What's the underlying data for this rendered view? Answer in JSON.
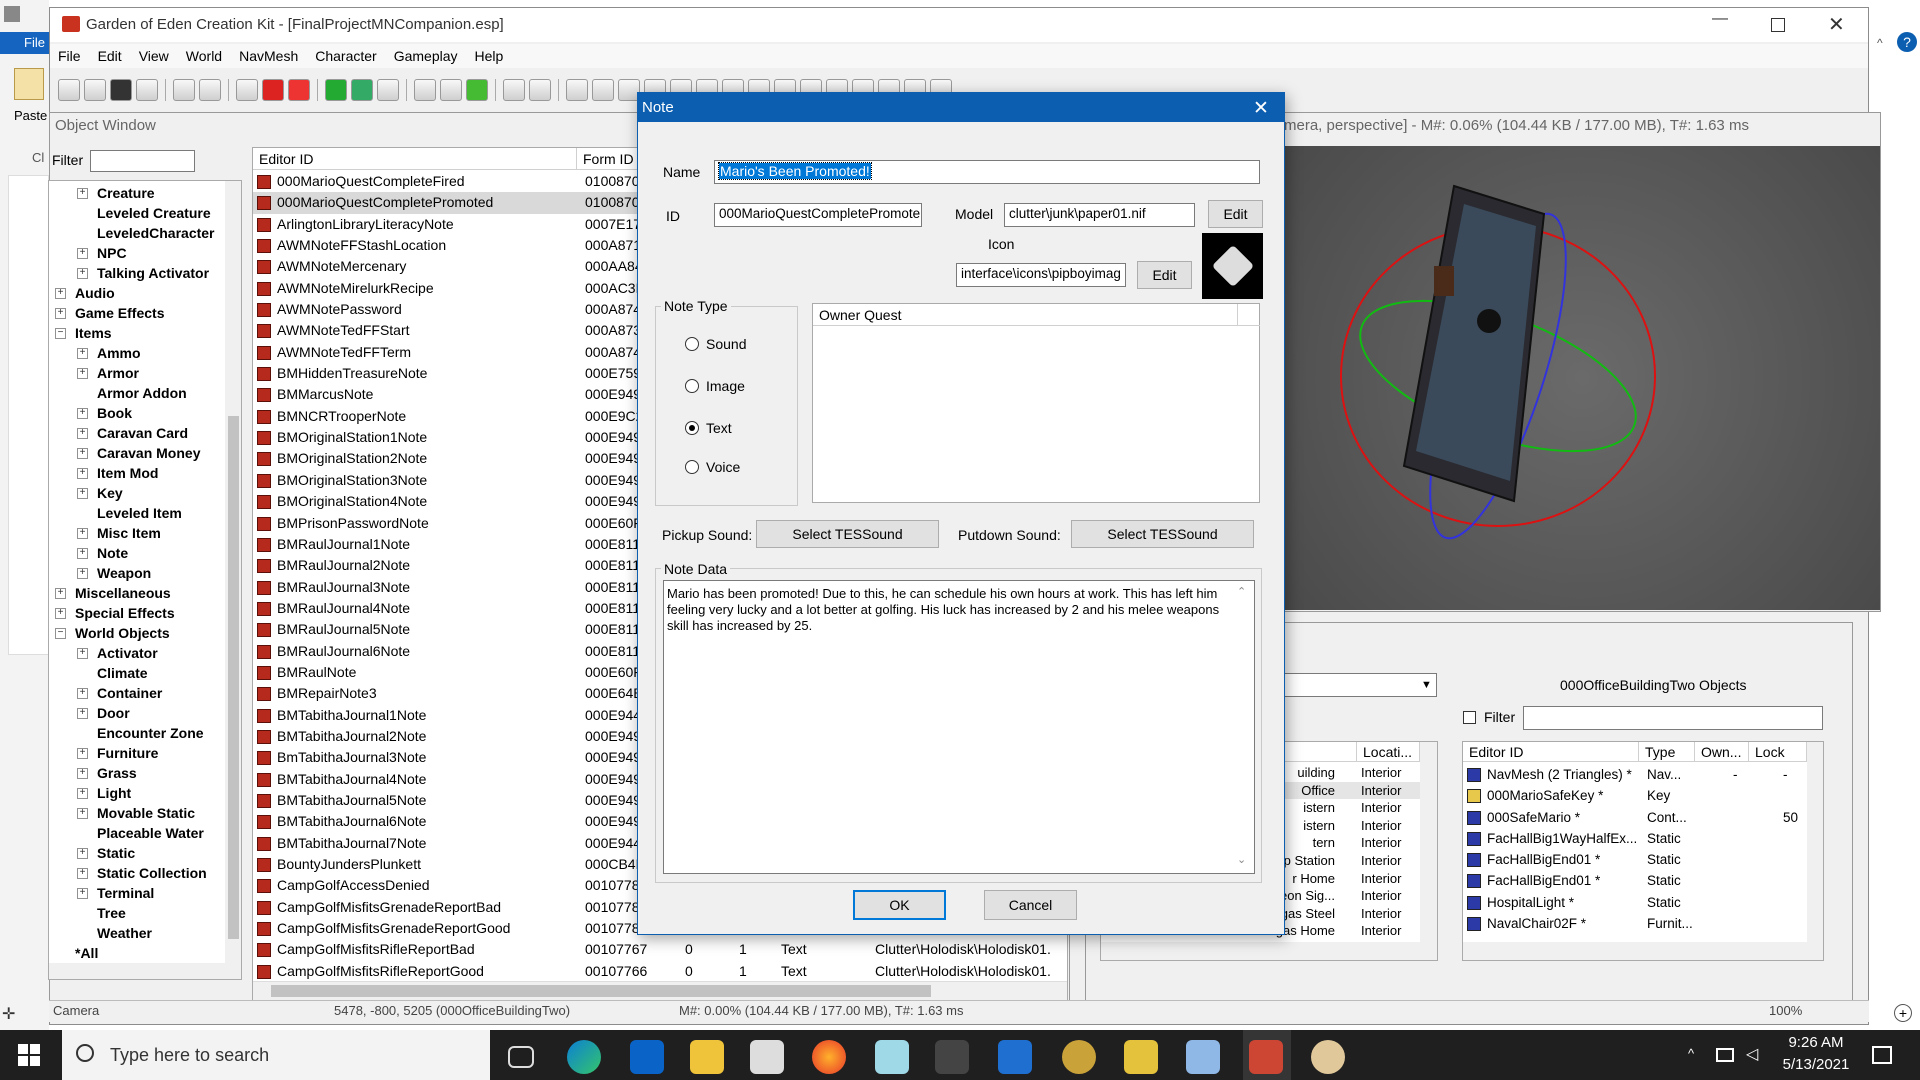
{
  "titlebar": {
    "title": "Garden of Eden Creation Kit - [FinalProjectMNCompanion.esp]"
  },
  "left_ribbon": {
    "file_tab": "File",
    "paste_label": "Paste",
    "cl_label": "Cl"
  },
  "menu": [
    "File",
    "Edit",
    "View",
    "World",
    "NavMesh",
    "Character",
    "Gameplay",
    "Help"
  ],
  "object_window": {
    "title": "Object Window",
    "filter_label": "Filter",
    "tree": [
      {
        "label": "Creature",
        "indent": 1,
        "toggle": "+"
      },
      {
        "label": "Leveled Creature",
        "indent": 2,
        "toggle": ""
      },
      {
        "label": "LeveledCharacter",
        "indent": 2,
        "toggle": ""
      },
      {
        "label": "NPC",
        "indent": 1,
        "toggle": "+"
      },
      {
        "label": "Talking Activator",
        "indent": 1,
        "toggle": "+"
      },
      {
        "label": "Audio",
        "indent": 0,
        "toggle": "+"
      },
      {
        "label": "Game Effects",
        "indent": 0,
        "toggle": "+"
      },
      {
        "label": "Items",
        "indent": 0,
        "toggle": "-"
      },
      {
        "label": "Ammo",
        "indent": 1,
        "toggle": "+"
      },
      {
        "label": "Armor",
        "indent": 1,
        "toggle": "+"
      },
      {
        "label": "Armor Addon",
        "indent": 2,
        "toggle": ""
      },
      {
        "label": "Book",
        "indent": 1,
        "toggle": "+"
      },
      {
        "label": "Caravan Card",
        "indent": 1,
        "toggle": "+"
      },
      {
        "label": "Caravan Money",
        "indent": 1,
        "toggle": "+"
      },
      {
        "label": "Item Mod",
        "indent": 1,
        "toggle": "+"
      },
      {
        "label": "Key",
        "indent": 1,
        "toggle": "+"
      },
      {
        "label": "Leveled Item",
        "indent": 2,
        "toggle": ""
      },
      {
        "label": "Misc Item",
        "indent": 1,
        "toggle": "+"
      },
      {
        "label": "Note",
        "indent": 1,
        "toggle": "+"
      },
      {
        "label": "Weapon",
        "indent": 1,
        "toggle": "+"
      },
      {
        "label": "Miscellaneous",
        "indent": 0,
        "toggle": "+"
      },
      {
        "label": "Special Effects",
        "indent": 0,
        "toggle": "+"
      },
      {
        "label": "World Objects",
        "indent": 0,
        "toggle": "-"
      },
      {
        "label": "Activator",
        "indent": 1,
        "toggle": "+"
      },
      {
        "label": "Climate",
        "indent": 2,
        "toggle": ""
      },
      {
        "label": "Container",
        "indent": 1,
        "toggle": "+"
      },
      {
        "label": "Door",
        "indent": 1,
        "toggle": "+"
      },
      {
        "label": "Encounter Zone",
        "indent": 2,
        "toggle": ""
      },
      {
        "label": "Furniture",
        "indent": 1,
        "toggle": "+"
      },
      {
        "label": "Grass",
        "indent": 1,
        "toggle": "+"
      },
      {
        "label": "Light",
        "indent": 1,
        "toggle": "+"
      },
      {
        "label": "Movable Static",
        "indent": 1,
        "toggle": "+"
      },
      {
        "label": "Placeable Water",
        "indent": 2,
        "toggle": ""
      },
      {
        "label": "Static",
        "indent": 1,
        "toggle": "+"
      },
      {
        "label": "Static Collection",
        "indent": 1,
        "toggle": "+"
      },
      {
        "label": "Terminal",
        "indent": 1,
        "toggle": "+"
      },
      {
        "label": "Tree",
        "indent": 2,
        "toggle": ""
      },
      {
        "label": "Weather",
        "indent": 2,
        "toggle": ""
      },
      {
        "label": "*All",
        "indent": 0,
        "toggle": ""
      }
    ],
    "list_headers": [
      "Editor ID",
      "Form ID"
    ],
    "rows": [
      [
        "000MarioQuestCompleteFired",
        "0100870"
      ],
      [
        "000MarioQuestCompletePromoted",
        "0100870"
      ],
      [
        "ArlingtonLibraryLiteracyNote",
        "0007E17"
      ],
      [
        "AWMNoteFFStashLocation",
        "000A871"
      ],
      [
        "AWMNoteMercenary",
        "000AA84"
      ],
      [
        "AWMNoteMirelurkRecipe",
        "000AC3E"
      ],
      [
        "AWMNotePassword",
        "000A874"
      ],
      [
        "AWMNoteTedFFStart",
        "000A873"
      ],
      [
        "AWMNoteTedFFTerm",
        "000A874"
      ],
      [
        "BMHiddenTreasureNote",
        "000E759"
      ],
      [
        "BMMarcusNote",
        "000E949"
      ],
      [
        "BMNCRTrooperNote",
        "000E9C2"
      ],
      [
        "BMOriginalStation1Note",
        "000E949"
      ],
      [
        "BMOriginalStation2Note",
        "000E949"
      ],
      [
        "BMOriginalStation3Note",
        "000E949"
      ],
      [
        "BMOriginalStation4Note",
        "000E949"
      ],
      [
        "BMPrisonPasswordNote",
        "000E60F"
      ],
      [
        "BMRaulJournal1Note",
        "000E811"
      ],
      [
        "BMRaulJournal2Note",
        "000E811"
      ],
      [
        "BMRaulJournal3Note",
        "000E811"
      ],
      [
        "BMRaulJournal4Note",
        "000E811"
      ],
      [
        "BMRaulJournal5Note",
        "000E811"
      ],
      [
        "BMRaulJournal6Note",
        "000E811"
      ],
      [
        "BMRaulNote",
        "000E60F"
      ],
      [
        "BMRepairNote3",
        "000E64B"
      ],
      [
        "BMTabithaJournal1Note",
        "000E944"
      ],
      [
        "BMTabithaJournal2Note",
        "000E949"
      ],
      [
        "BmTabithaJournal3Note",
        "000E949"
      ],
      [
        "BMTabithaJournal4Note",
        "000E949"
      ],
      [
        "BMTabithaJournal5Note",
        "000E949"
      ],
      [
        "BMTabithaJournal6Note",
        "000E949"
      ],
      [
        "BMTabithaJournal7Note",
        "000E944"
      ],
      [
        "BountyJundersPlunkett",
        "000CB4F"
      ],
      [
        "CampGolfAccessDenied",
        "0010778"
      ],
      [
        "CampGolfMisfitsGrenadeReportBad",
        "0010778"
      ],
      [
        "CampGolfMisfitsGrenadeReportGood",
        "0010778"
      ],
      [
        "CampGolfMisfitsRifleReportBad",
        "00107767"
      ],
      [
        "CampGolfMisfitsRifleReportGood",
        "00107766"
      ]
    ],
    "extra_cols": [
      {
        "count": "0",
        "users": "1",
        "type": "Text",
        "model": "Clutter\\Holodisk\\Holodisk01."
      },
      {
        "count": "0",
        "users": "1",
        "type": "Text",
        "model": "Clutter\\Holodisk\\Holodisk01."
      }
    ]
  },
  "render": {
    "title": "mera, perspective] - M#: 0.06% (104.44 KB / 177.00 MB), T#: 1.63 ms"
  },
  "cell_view": {
    "objects_title": "000OfficeBuildingTwo Objects",
    "filter_label": "Filter",
    "left_headers": [
      "",
      "Locati..."
    ],
    "left_rows": [
      [
        "uilding",
        "Interior"
      ],
      [
        "Office",
        "Interior"
      ],
      [
        "istern",
        "Interior"
      ],
      [
        "istern",
        "Interior"
      ],
      [
        "tern",
        "Interior"
      ],
      [
        "mp Station",
        "Interior"
      ],
      [
        "r Home",
        "Interior"
      ],
      [
        "Neon Sig...",
        "Interior"
      ],
      [
        "gas Steel",
        "Interior"
      ],
      [
        "Neon Vegas Home",
        "Interior"
      ]
    ],
    "right_headers": [
      "Editor ID",
      "Type",
      "Own...",
      "Lock"
    ],
    "right_rows": [
      [
        "NavMesh (2 Triangles) *",
        "Nav...",
        "-",
        "-"
      ],
      [
        "000MarioSafeKey *",
        "Key",
        "",
        ""
      ],
      [
        "000SafeMario *",
        "Cont...",
        "",
        "50"
      ],
      [
        "FacHallBig1WayHalfEx...",
        "Static",
        "",
        ""
      ],
      [
        "FacHallBigEnd01 *",
        "Static",
        "",
        ""
      ],
      [
        "FacHallBigEnd01 *",
        "Static",
        "",
        ""
      ],
      [
        "HospitalLight *",
        "Static",
        "",
        ""
      ],
      [
        "NavalChair02F *",
        "Furnit...",
        "",
        ""
      ]
    ]
  },
  "status": {
    "left": "Camera",
    "mid": "5478, -800, 5205 (000OfficeBuildingTwo)",
    "right": "M#: 0.00% (104.44 KB / 177.00 MB), T#: 1.63 ms",
    "zoom": "100%"
  },
  "dialog": {
    "title": "Note",
    "name_label": "Name",
    "name_value": "Mario's Been Promoted!",
    "id_label": "ID",
    "id_value": "000MarioQuestCompletePromote",
    "model_label": "Model",
    "model_value": "clutter\\junk\\paper01.nif",
    "edit_label": "Edit",
    "icon_label": "Icon",
    "icon_value": "interface\\icons\\pipboyimag",
    "note_type_label": "Note Type",
    "note_types": [
      "Sound",
      "Image",
      "Text",
      "Voice"
    ],
    "selected_type": "Text",
    "owner_quest_label": "Owner Quest",
    "pickup_label": "Pickup Sound:",
    "putdown_label": "Putdown Sound:",
    "select_sound": "Select TESSound",
    "note_data_label": "Note Data",
    "note_data": "Mario has been promoted! Due to this, he can schedule his own hours at work. This has left him feeling very lucky and a lot better at golfing. His luck has increased by 2 and his melee weapons skill has increased by 25.",
    "ok": "OK",
    "cancel": "Cancel"
  },
  "taskbar": {
    "search_placeholder": "Type here to search",
    "time": "9:26 AM",
    "date": "5/13/2021"
  },
  "colors": {
    "accent": "#0078d7",
    "dialog_title": "#0b5eb0",
    "taskbar": "#1f1f1f",
    "icon_red": "#b52a1d"
  }
}
